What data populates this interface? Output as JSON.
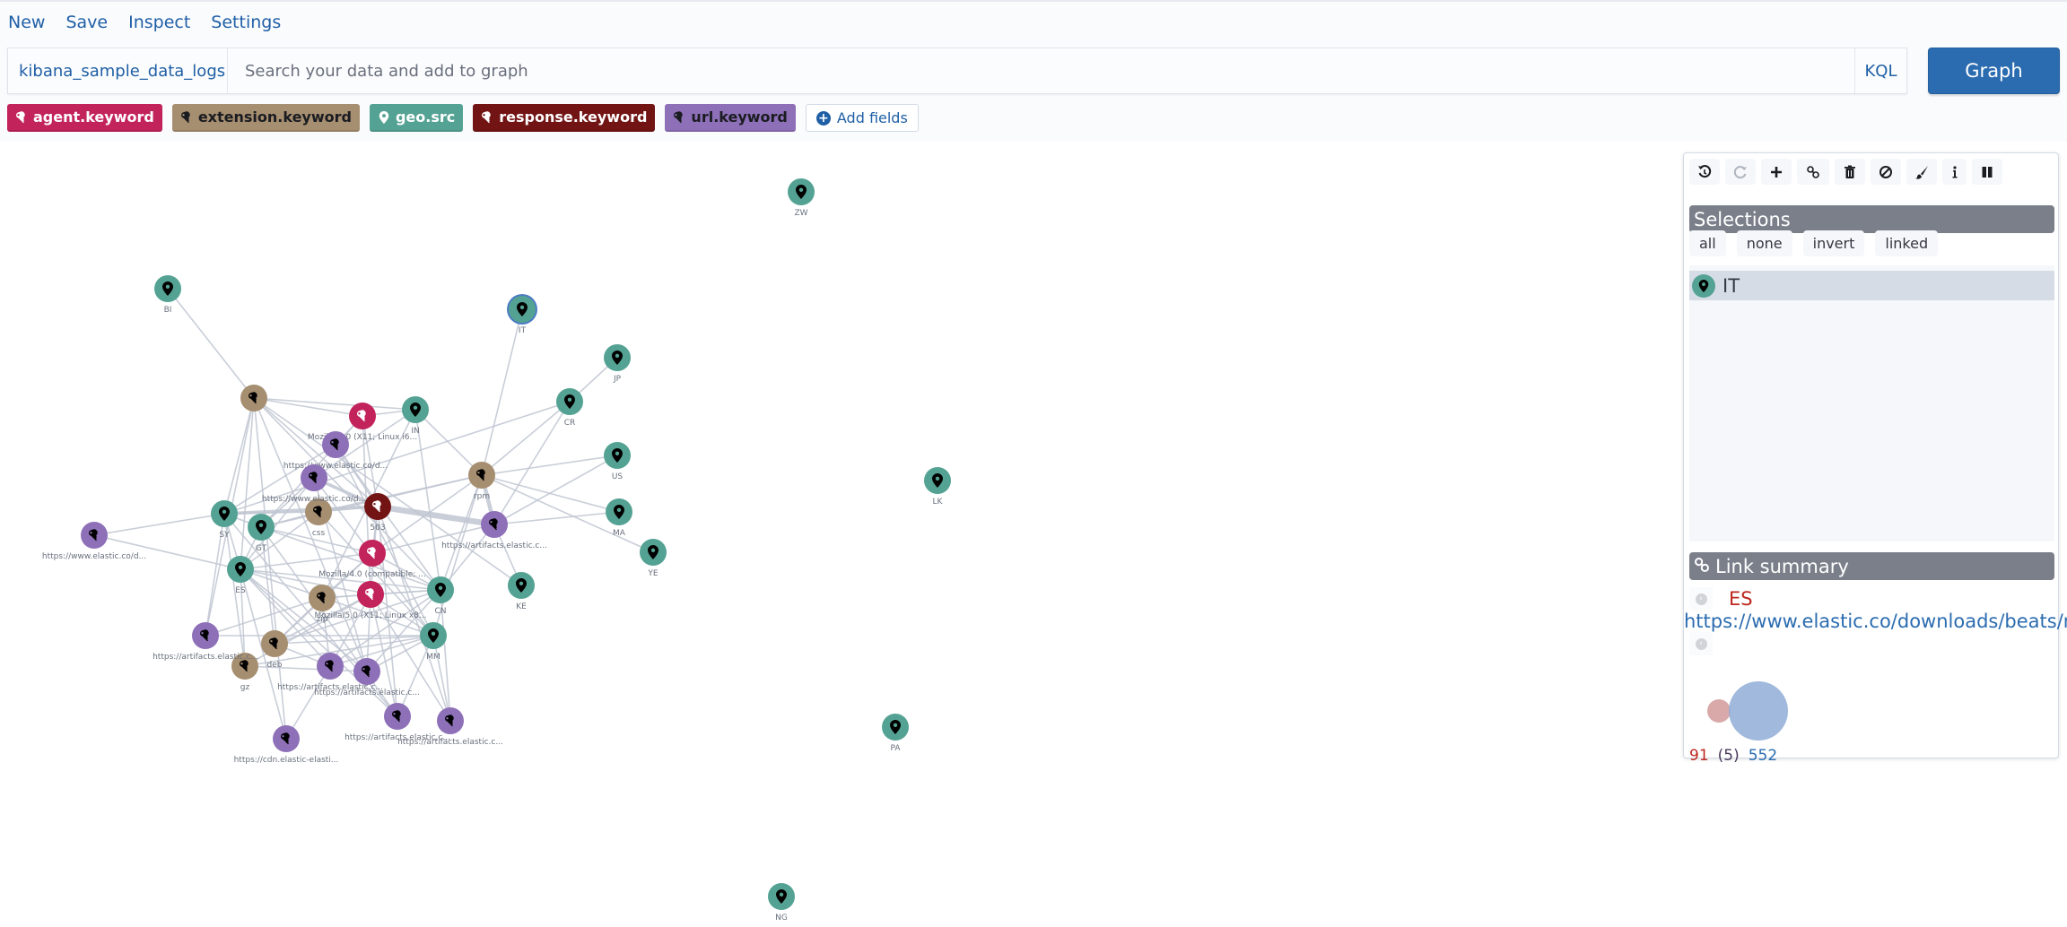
{
  "menu": [
    "New",
    "Save",
    "Inspect",
    "Settings"
  ],
  "search": {
    "index_pattern": "kibana_sample_data_logs",
    "placeholder": "Search your data and add to graph",
    "value": "",
    "query_language": "KQL",
    "submit_label": "Graph"
  },
  "fields": [
    {
      "label": "agent.keyword",
      "icon": "key-icon",
      "color": "#c2235a",
      "text_color": "#ffffff"
    },
    {
      "label": "extension.keyword",
      "icon": "key-icon",
      "color": "#a68e70",
      "text_color": "#1a1c21"
    },
    {
      "label": "geo.src",
      "icon": "map-marker-icon",
      "color": "#54a293",
      "text_color": "#ffffff"
    },
    {
      "label": "response.keyword",
      "icon": "key-icon",
      "color": "#721414",
      "text_color": "#ffffff"
    },
    {
      "label": "url.keyword",
      "icon": "key-icon",
      "color": "#8e70b8",
      "text_color": "#1a1c21"
    }
  ],
  "add_fields_label": "Add fields",
  "graph": {
    "edge_color": "#c0c5d1",
    "nodes": [
      {
        "id": "BI",
        "label": "BI",
        "field": "geo.src"
      },
      {
        "id": "IT",
        "label": "IT",
        "field": "geo.src",
        "selected": true
      },
      {
        "id": "JP",
        "label": "JP",
        "field": "geo.src"
      },
      {
        "id": "CR",
        "label": "CR",
        "field": "geo.src"
      },
      {
        "id": "US",
        "label": "US",
        "field": "geo.src"
      },
      {
        "id": "MA",
        "label": "MA",
        "field": "geo.src"
      },
      {
        "id": "YE",
        "label": "YE",
        "field": "geo.src"
      },
      {
        "id": "KE",
        "label": "KE",
        "field": "geo.src"
      },
      {
        "id": "IN",
        "label": "IN",
        "field": "geo.src"
      },
      {
        "id": "SY",
        "label": "SY",
        "field": "geo.src"
      },
      {
        "id": "GT",
        "label": "GT",
        "field": "geo.src"
      },
      {
        "id": "ES",
        "label": "ES",
        "field": "geo.src"
      },
      {
        "id": "CN",
        "label": "CN",
        "field": "geo.src"
      },
      {
        "id": "MM",
        "label": "MM",
        "field": "geo.src"
      },
      {
        "id": "ZW",
        "label": "ZW",
        "field": "geo.src"
      },
      {
        "id": "LK",
        "label": "LK",
        "field": "geo.src"
      },
      {
        "id": "PA",
        "label": "PA",
        "field": "geo.src"
      },
      {
        "id": "NG",
        "label": "NG",
        "field": "geo.src"
      },
      {
        "id": "rpm",
        "label": "rpm",
        "field": "extension.keyword"
      },
      {
        "id": "ext1",
        "label": "",
        "field": "extension.keyword"
      },
      {
        "id": "css",
        "label": "css",
        "field": "extension.keyword"
      },
      {
        "id": "zip",
        "label": "zip",
        "field": "extension.keyword"
      },
      {
        "id": "deb",
        "label": "deb",
        "field": "extension.keyword"
      },
      {
        "id": "gz",
        "label": "gz",
        "field": "extension.keyword"
      },
      {
        "id": "503",
        "label": "503",
        "field": "response.keyword"
      },
      {
        "id": "ag1",
        "label": "Mozilla/5.0 (X11; Linux i6...",
        "field": "agent.keyword"
      },
      {
        "id": "ag2",
        "label": "Mozilla/4.0 (compatible; ...",
        "field": "agent.keyword"
      },
      {
        "id": "ag3",
        "label": "Mozilla/5.0 (X11; Linux x8...",
        "field": "agent.keyword"
      },
      {
        "id": "u1",
        "label": "https://www.elastic.co/d...",
        "field": "url.keyword"
      },
      {
        "id": "u2",
        "label": "https://www.elastic.co/d...",
        "field": "url.keyword"
      },
      {
        "id": "u3",
        "label": "https://www.elastic.co/d...",
        "field": "url.keyword"
      },
      {
        "id": "u4",
        "label": "https://artifacts.elastic.c...",
        "field": "url.keyword"
      },
      {
        "id": "u5",
        "label": "https://artifacts.elastic.c...",
        "field": "url.keyword"
      },
      {
        "id": "u6",
        "label": "https://artifacts.elastic.c...",
        "field": "url.keyword"
      },
      {
        "id": "u7",
        "label": "https://artifacts.elastic.c...",
        "field": "url.keyword"
      },
      {
        "id": "u8",
        "label": "https://artifacts.elastic.c...",
        "field": "url.keyword"
      },
      {
        "id": "u9",
        "label": "https://artifacts.elastic.c...",
        "field": "url.keyword"
      },
      {
        "id": "u10",
        "label": "https://cdn.elastic-elasti...",
        "field": "url.keyword"
      }
    ],
    "edges": [
      [
        "BI",
        "ext1"
      ],
      [
        "IT",
        "rpm"
      ],
      [
        "JP",
        "CR"
      ],
      [
        "CR",
        "rpm"
      ],
      [
        "CR",
        "u4"
      ],
      [
        "CR",
        "SY"
      ],
      [
        "US",
        "rpm"
      ],
      [
        "US",
        "u4"
      ],
      [
        "MA",
        "rpm"
      ],
      [
        "MA",
        "u4"
      ],
      [
        "YE",
        "rpm"
      ],
      [
        "KE",
        "u4"
      ],
      [
        "KE",
        "ext1"
      ],
      [
        "rpm",
        "u4",
        3
      ],
      [
        "503",
        "u4",
        5
      ],
      [
        "503",
        "SY",
        2
      ],
      [
        "503",
        "css"
      ],
      [
        "503",
        "ag2"
      ],
      [
        "503",
        "ag3"
      ],
      [
        "ext1",
        "ag1"
      ],
      [
        "ext1",
        "IN"
      ],
      [
        "ext1",
        "SY"
      ],
      [
        "ext1",
        "ES"
      ],
      [
        "ext1",
        "503"
      ],
      [
        "ext1",
        "CN"
      ],
      [
        "ag1",
        "IN"
      ],
      [
        "ag1",
        "503"
      ],
      [
        "ag1",
        "u1"
      ],
      [
        "ag1",
        "ag3"
      ],
      [
        "ag1",
        "GT"
      ],
      [
        "IN",
        "rpm"
      ],
      [
        "IN",
        "CN"
      ],
      [
        "IN",
        "u2"
      ],
      [
        "IN",
        "zip"
      ],
      [
        "u1",
        "SY"
      ],
      [
        "u1",
        "503"
      ],
      [
        "u1",
        "CN"
      ],
      [
        "u1",
        "MM"
      ],
      [
        "u2",
        "503",
        2
      ],
      [
        "u2",
        "ES"
      ],
      [
        "u2",
        "GT"
      ],
      [
        "u2",
        "u7"
      ],
      [
        "u2",
        "MM"
      ],
      [
        "css",
        "SY"
      ],
      [
        "css",
        "GT"
      ],
      [
        "css",
        "ES"
      ],
      [
        "css",
        "rpm"
      ],
      [
        "css",
        "MM"
      ],
      [
        "SY",
        "u3"
      ],
      [
        "SY",
        "GT"
      ],
      [
        "SY",
        "ES"
      ],
      [
        "SY",
        "u5"
      ],
      [
        "SY",
        "gz"
      ],
      [
        "GT",
        "ES"
      ],
      [
        "GT",
        "ag2"
      ],
      [
        "GT",
        "CN"
      ],
      [
        "GT",
        "deb"
      ],
      [
        "GT",
        "u8"
      ],
      [
        "GT",
        "rpm"
      ],
      [
        "u3",
        "ES"
      ],
      [
        "ES",
        "ag2"
      ],
      [
        "ES",
        "ag3"
      ],
      [
        "ES",
        "CN"
      ],
      [
        "ES",
        "MM"
      ],
      [
        "ES",
        "gz"
      ],
      [
        "ES",
        "u6"
      ],
      [
        "ES",
        "u7"
      ],
      [
        "ES",
        "u10"
      ],
      [
        "ES",
        "u8"
      ],
      [
        "ag2",
        "CN"
      ],
      [
        "ag2",
        "zip"
      ],
      [
        "ag2",
        "u4"
      ],
      [
        "ag2",
        "rpm"
      ],
      [
        "ag2",
        "deb"
      ],
      [
        "ag3",
        "CN"
      ],
      [
        "ag3",
        "MM"
      ],
      [
        "ag3",
        "zip"
      ],
      [
        "ag3",
        "u6"
      ],
      [
        "ag3",
        "u7"
      ],
      [
        "ag3",
        "u8"
      ],
      [
        "ag3",
        "u9"
      ],
      [
        "ag3",
        "deb"
      ],
      [
        "ag3",
        "gz"
      ],
      [
        "zip",
        "CN"
      ],
      [
        "zip",
        "u5"
      ],
      [
        "zip",
        "deb"
      ],
      [
        "zip",
        "u6"
      ],
      [
        "CN",
        "rpm"
      ],
      [
        "CN",
        "u4"
      ],
      [
        "CN",
        "u6"
      ],
      [
        "CN",
        "u7"
      ],
      [
        "CN",
        "u9"
      ],
      [
        "CN",
        "deb"
      ],
      [
        "MM",
        "u5"
      ],
      [
        "MM",
        "deb"
      ],
      [
        "MM",
        "gz"
      ],
      [
        "MM",
        "u6"
      ],
      [
        "MM",
        "u7"
      ],
      [
        "MM",
        "u8"
      ],
      [
        "MM",
        "u9"
      ],
      [
        "MM",
        "rpm"
      ],
      [
        "u5",
        "ext1"
      ],
      [
        "deb",
        "u6"
      ],
      [
        "gz",
        "u7"
      ],
      [
        "u10",
        "u6"
      ],
      [
        "u10",
        "ext1"
      ],
      [
        "u8",
        "503"
      ],
      [
        "u9",
        "503"
      ],
      [
        "u8",
        "SY"
      ],
      [
        "u7",
        "ext1"
      ]
    ]
  },
  "panel": {
    "toolbar": [
      {
        "name": "undo",
        "icon": "undo-icon",
        "enabled": true
      },
      {
        "name": "redo",
        "icon": "redo-icon",
        "enabled": false
      },
      {
        "name": "expand",
        "icon": "plus-icon",
        "enabled": true
      },
      {
        "name": "link",
        "icon": "link-icon",
        "enabled": true
      },
      {
        "name": "delete",
        "icon": "trash-icon",
        "enabled": true
      },
      {
        "name": "block",
        "icon": "block-icon",
        "enabled": true
      },
      {
        "name": "style",
        "icon": "paint-brush-icon",
        "enabled": true
      },
      {
        "name": "info",
        "icon": "info-icon",
        "enabled": true
      },
      {
        "name": "pause",
        "icon": "pause-icon",
        "enabled": true
      }
    ],
    "selections_title": "Selections",
    "selection_buttons": [
      "all",
      "none",
      "invert",
      "linked"
    ],
    "selected_items": [
      {
        "label": "IT",
        "icon": "map-marker-icon"
      }
    ],
    "link_summary_title": "Link summary",
    "link": {
      "from": "ES",
      "to": "https://www.elastic.co/downloads/beats/m",
      "from_count": "91",
      "overlap_count": "(5)",
      "to_count": "552",
      "from_color": "#bd271e",
      "to_color": "#2b6cb0"
    }
  }
}
